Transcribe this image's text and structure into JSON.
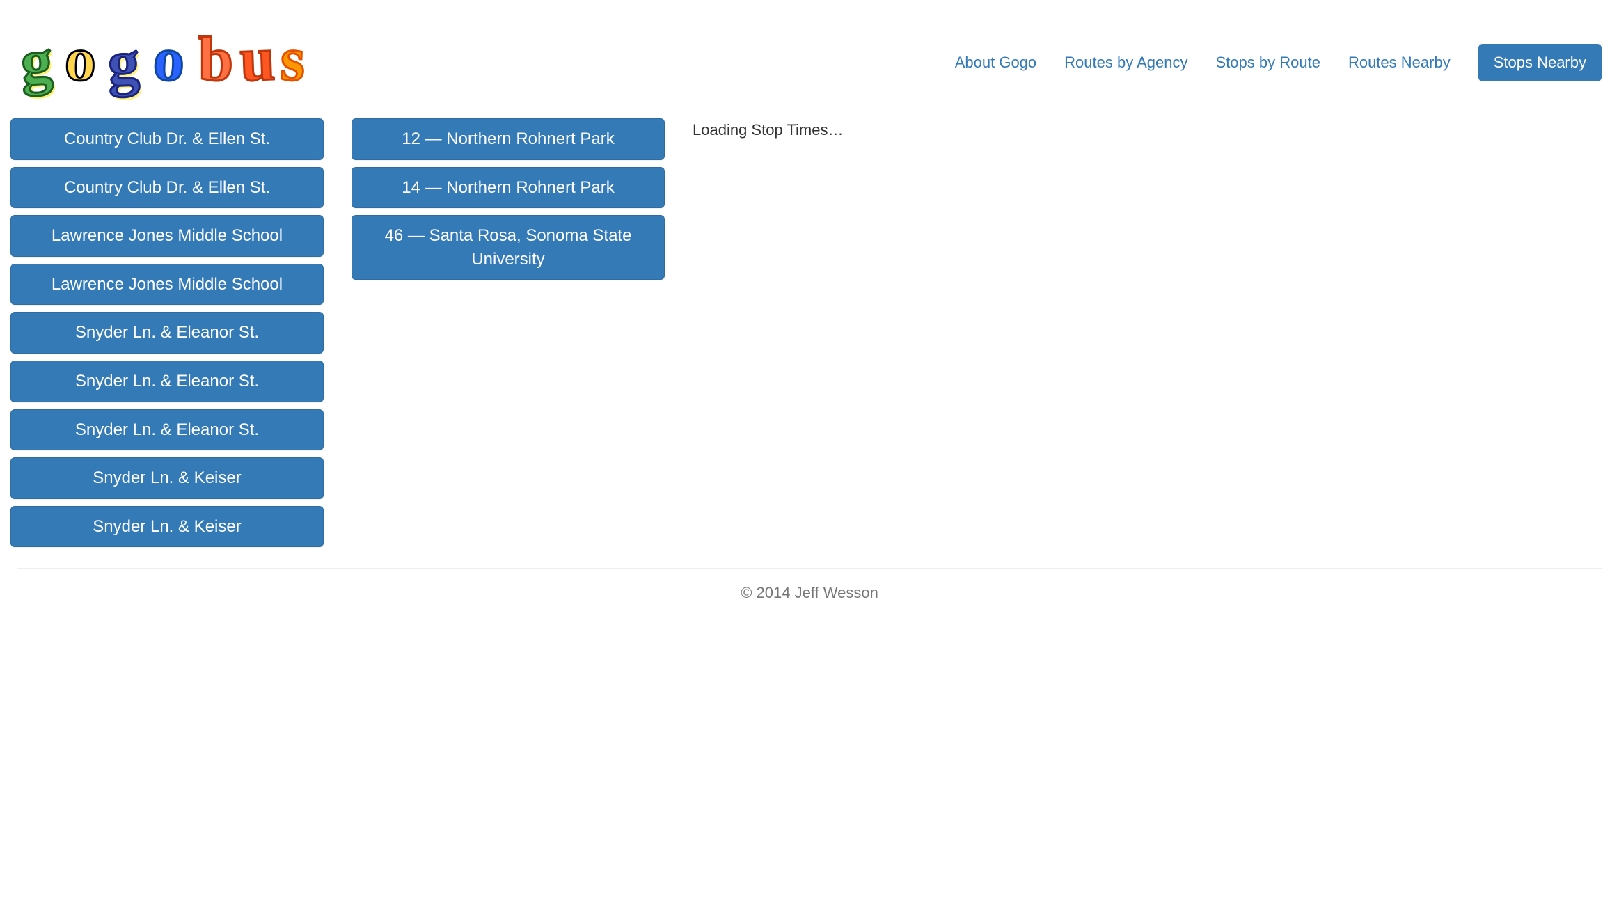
{
  "header": {
    "nav": [
      {
        "label": "About Gogo",
        "active": false
      },
      {
        "label": "Routes by Agency",
        "active": false
      },
      {
        "label": "Stops by Route",
        "active": false
      },
      {
        "label": "Routes Nearby",
        "active": false
      },
      {
        "label": "Stops Nearby",
        "active": true
      }
    ]
  },
  "stops": [
    {
      "label": "Country Club Dr. & Ellen St."
    },
    {
      "label": "Country Club Dr. & Ellen St."
    },
    {
      "label": "Lawrence Jones Middle School"
    },
    {
      "label": "Lawrence Jones Middle School"
    },
    {
      "label": "Snyder Ln. & Eleanor St."
    },
    {
      "label": "Snyder Ln. & Eleanor St."
    },
    {
      "label": "Snyder Ln. & Eleanor St."
    },
    {
      "label": "Snyder Ln. & Keiser"
    },
    {
      "label": "Snyder Ln. & Keiser"
    }
  ],
  "routes": [
    {
      "label": "12 — Northern Rohnert Park"
    },
    {
      "label": "14 — Northern Rohnert Park"
    },
    {
      "label": "46 — Santa Rosa, Sonoma State University"
    }
  ],
  "times": {
    "loading_text": "Loading Stop Times…"
  },
  "footer": {
    "copyright": "© 2014 Jeff Wesson"
  },
  "colors": {
    "primary": "#337ab7",
    "link": "#337ab7",
    "text": "#333333",
    "muted": "#777777"
  },
  "logo": {
    "text": "gogobus",
    "letters": [
      {
        "char": "g",
        "fill": "#4CAF50",
        "stroke": "#2E7D32"
      },
      {
        "char": "o",
        "fill": "#FFD54F",
        "stroke": "#F57F17"
      },
      {
        "char": "g",
        "fill": "#3F51B5",
        "stroke": "#283593"
      },
      {
        "char": "o",
        "fill": "#2196F3",
        "stroke": "#1565C0"
      },
      {
        "char": "b",
        "fill": "#FF7043",
        "stroke": "#D84315"
      },
      {
        "char": "u",
        "fill": "#FF5722",
        "stroke": "#BF360C"
      },
      {
        "char": "s",
        "fill": "#FF9800",
        "stroke": "#E65100"
      }
    ]
  }
}
